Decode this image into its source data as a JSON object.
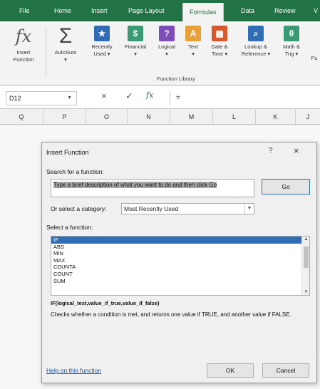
{
  "ribbon_tabs": [
    "File",
    "Home",
    "Insert",
    "Page Layout",
    "Formulas",
    "Data",
    "Review",
    "V"
  ],
  "active_tab": "Formulas",
  "ribbon": {
    "insert_function": [
      "Insert",
      "Function"
    ],
    "autosum": [
      "AutoSum",
      "▾"
    ],
    "recently_used": [
      "Recently",
      "Used ▾"
    ],
    "financial": [
      "Financial",
      "▾"
    ],
    "logical": [
      "Logical",
      "▾"
    ],
    "text": [
      "Text",
      "▾"
    ],
    "date_time": [
      "Date &",
      "Time ▾"
    ],
    "lookup": [
      "Lookup &",
      "Reference ▾"
    ],
    "math": [
      "Math &",
      "Trig ▾"
    ],
    "fu": [
      "Fu",
      ""
    ],
    "group_label": "Function Library"
  },
  "formula_bar": {
    "name_box": "D12",
    "cancel": "×",
    "enter": "✓",
    "fx": "fx",
    "value": "="
  },
  "columns": [
    "Q",
    "P",
    "O",
    "N",
    "M",
    "L",
    "K",
    "J"
  ],
  "dialog": {
    "title": "Insert Function",
    "help": "?",
    "close": "×",
    "search_label": "Search for a function:",
    "search_text": "Type a brief description of what you want to do and then click Go",
    "go": "Go",
    "category_label": "Or select a category:",
    "category_value": "Most Recently Used",
    "function_label": "Select a function:",
    "functions": [
      "IF",
      "ABS",
      "MIN",
      "MAX",
      "COUNTA",
      "COUNT",
      "SUM"
    ],
    "selected_function": "IF",
    "syntax": "IF(logical_test,value_if_true,value_if_false)",
    "description": "Checks whether a condition is met, and returns one value if TRUE, and another value if FALSE.",
    "help_link": "Help on this function",
    "ok": "OK",
    "cancel": "Cancel"
  },
  "colors": {
    "ribbon_green": "#217346",
    "selection_blue": "#2f6db5"
  },
  "icons": {
    "fx": "insert-function-icon",
    "sigma": "autosum-icon",
    "star": "recently-used-icon",
    "financial": "financial-icon",
    "logical": "logical-icon",
    "text": "text-icon",
    "date": "date-time-icon",
    "lookup": "lookup-icon",
    "math": "math-trig-icon"
  }
}
